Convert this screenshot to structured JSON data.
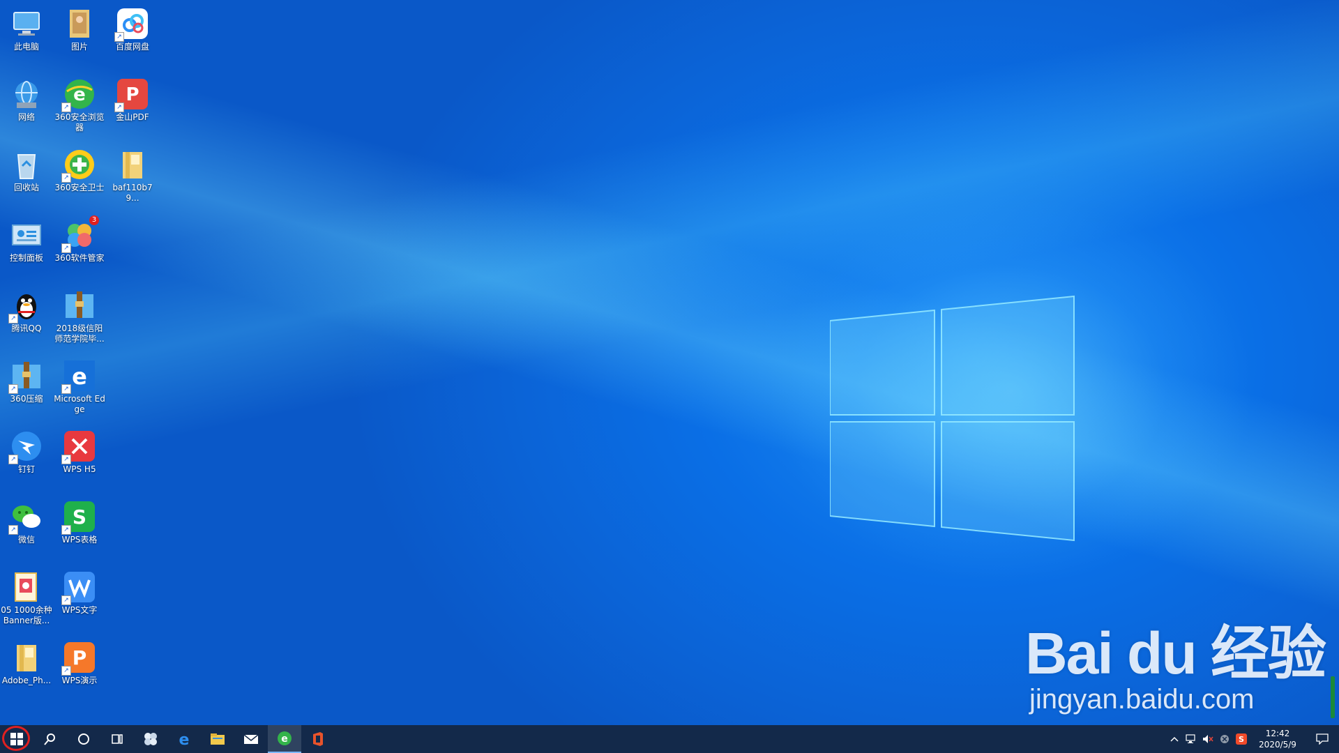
{
  "desktop": {
    "icons": [
      {
        "label": "此电脑",
        "icon": "computer-icon"
      },
      {
        "label": "图片",
        "icon": "pictures-folder-icon"
      },
      {
        "label": "百度网盘",
        "icon": "baidu-netdisk-icon"
      },
      {
        "label": "网络",
        "icon": "network-icon"
      },
      {
        "label": "360安全浏览器",
        "icon": "360-browser-icon"
      },
      {
        "label": "金山PDF",
        "icon": "kingsoft-pdf-icon"
      },
      {
        "label": "回收站",
        "icon": "recycle-bin-icon"
      },
      {
        "label": "360安全卫士",
        "icon": "360-security-icon"
      },
      {
        "label": "baf110b79...",
        "icon": "folder-icon"
      },
      {
        "label": "控制面板",
        "icon": "control-panel-icon"
      },
      {
        "label": "360软件管家",
        "icon": "360-software-manager-icon",
        "badge": "3"
      },
      {
        "label": "腾讯QQ",
        "icon": "qq-icon"
      },
      {
        "label": "2018级信阳师范学院毕...",
        "icon": "archive-icon"
      },
      {
        "label": "360压缩",
        "icon": "360-zip-icon"
      },
      {
        "label": "Microsoft Edge",
        "icon": "edge-icon"
      },
      {
        "label": "钉钉",
        "icon": "dingtalk-icon"
      },
      {
        "label": "WPS H5",
        "icon": "wps-h5-icon"
      },
      {
        "label": "微信",
        "icon": "wechat-icon"
      },
      {
        "label": "WPS表格",
        "icon": "wps-spreadsheet-icon"
      },
      {
        "label": "05 1000余种Banner版...",
        "icon": "document-icon"
      },
      {
        "label": "WPS文字",
        "icon": "wps-writer-icon"
      },
      {
        "label": "Adobe_Ph...",
        "icon": "folder-icon"
      },
      {
        "label": "WPS演示",
        "icon": "wps-presentation-icon"
      }
    ]
  },
  "watermark": {
    "brand": "Bai du 经验",
    "url": "jingyan.baidu.com"
  },
  "taskbar": {
    "items": [
      {
        "icon": "windows-start-icon"
      },
      {
        "icon": "search-icon"
      },
      {
        "icon": "cortana-icon"
      },
      {
        "icon": "task-view-icon"
      },
      {
        "icon": "pinwheel-app-icon"
      },
      {
        "icon": "edge-icon"
      },
      {
        "icon": "file-explorer-icon"
      },
      {
        "icon": "mail-icon"
      },
      {
        "icon": "360-browser-icon"
      },
      {
        "icon": "office-icon"
      }
    ],
    "tray": {
      "icons": [
        "chevron-up-icon",
        "network-icon",
        "volume-muted-icon",
        "close-circle-icon",
        "sogou-ime-icon"
      ],
      "time": "12:42",
      "date": "2020/5/9"
    }
  },
  "colors": {
    "accent": "#0a6fe6",
    "taskbar": "#13294a",
    "start_highlight": "#e02020"
  }
}
